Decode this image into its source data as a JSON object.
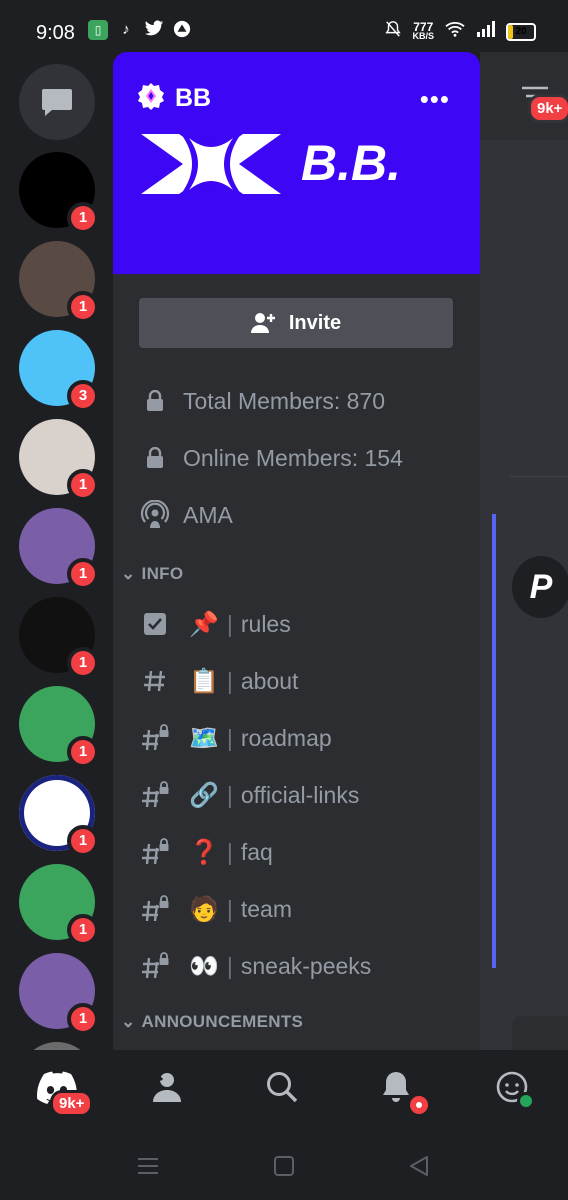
{
  "status_bar": {
    "time": "9:08",
    "net_speed_value": "777",
    "net_speed_unit": "KB/S",
    "battery": "20"
  },
  "server_rail": {
    "servers": [
      {
        "name": "solana-server",
        "badge": "1",
        "color": "#000000"
      },
      {
        "name": "photo-avatar-server",
        "badge": "1",
        "color": "#5a4a44"
      },
      {
        "name": "blue-face-server",
        "badge": "3",
        "color": "#4fc3f7"
      },
      {
        "name": "sketch-avatar-server",
        "badge": "1",
        "color": "#d9d2cc"
      },
      {
        "name": "bird-art-server",
        "badge": "1",
        "color": "#7b5ea8"
      },
      {
        "name": "skeleton-server",
        "badge": "1",
        "color": "#111111"
      },
      {
        "name": "discord-green-server",
        "badge": "1",
        "color": "#3ba55d"
      },
      {
        "name": "discord-blue-server",
        "badge": "1",
        "color": "#ffffff"
      },
      {
        "name": "discord-green-server-2",
        "badge": "1",
        "color": "#3ba55d"
      },
      {
        "name": "bird-art-server-2",
        "badge": "1",
        "color": "#7b5ea8"
      }
    ]
  },
  "server": {
    "name": "BB",
    "banner_text": "B.B.",
    "banner_color": "#3d06f5",
    "invite_label": "Invite"
  },
  "channels_top": [
    {
      "icon": "lock-icon",
      "label": "Total Members: 870"
    },
    {
      "icon": "lock-icon",
      "label": "Online Members: 154"
    },
    {
      "icon": "stage-icon",
      "label": "AMA"
    }
  ],
  "categories": {
    "info": "INFO",
    "announcements": "ANNOUNCEMENTS"
  },
  "info_channels": [
    {
      "icon": "rules-icon",
      "emoji": "📌",
      "sep": "|",
      "label": "rules"
    },
    {
      "icon": "hash-icon",
      "emoji": "📋",
      "sep": "|",
      "label": "about"
    },
    {
      "icon": "locked-hash-icon",
      "emoji": "🗺️",
      "sep": "|",
      "label": "roadmap"
    },
    {
      "icon": "locked-hash-icon",
      "emoji": "🔗",
      "sep": "|",
      "label": "official-links"
    },
    {
      "icon": "locked-hash-icon",
      "emoji": "❓",
      "sep": "|",
      "label": "faq"
    },
    {
      "icon": "locked-hash-icon",
      "emoji": "🧑",
      "sep": "|",
      "label": "team"
    },
    {
      "icon": "locked-hash-icon",
      "emoji": "👀",
      "sep": "|",
      "label": "sneak-peeks"
    }
  ],
  "peek": {
    "badge": "9k+"
  },
  "bottom_nav": {
    "home_badge": "9k+"
  },
  "colors": {
    "accent_red": "#f23f43",
    "panel": "#2b2d31",
    "rail": "#1e1f22"
  }
}
